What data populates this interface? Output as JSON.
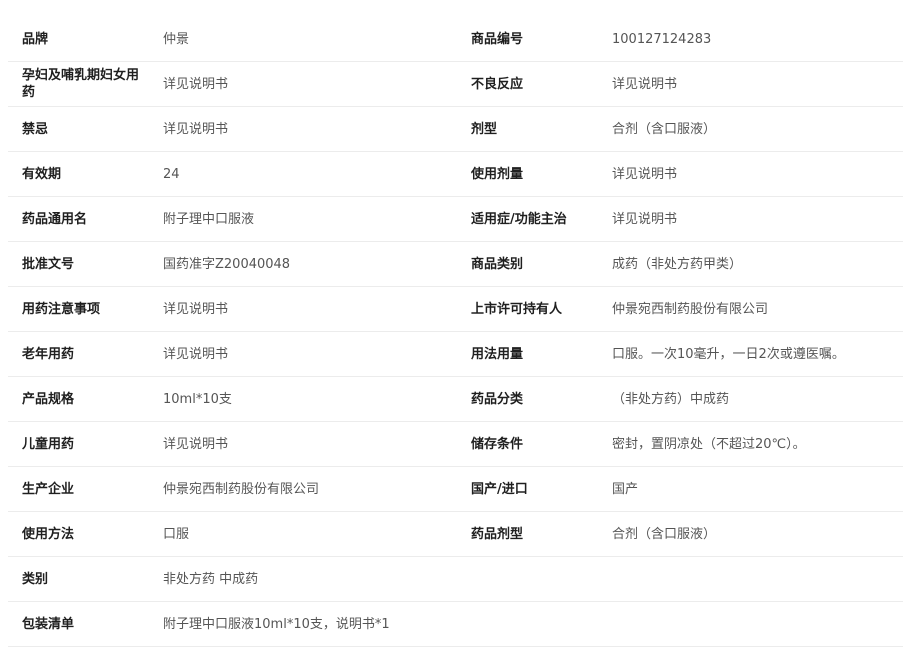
{
  "rows": [
    {
      "k1": "品牌",
      "v1": "仲景",
      "k2": "商品编号",
      "v2": "100127124283"
    },
    {
      "k1": "孕妇及哺乳期妇女用药",
      "v1": "详见说明书",
      "k2": "不良反应",
      "v2": "详见说明书"
    },
    {
      "k1": "禁忌",
      "v1": "详见说明书",
      "k2": "剂型",
      "v2": "合剂（含口服液）"
    },
    {
      "k1": "有效期",
      "v1": "24",
      "k2": "使用剂量",
      "v2": "详见说明书"
    },
    {
      "k1": "药品通用名",
      "v1": "附子理中口服液",
      "k2": "适用症/功能主治",
      "v2": "详见说明书"
    },
    {
      "k1": "批准文号",
      "v1": "国药准字Z20040048",
      "k2": "商品类别",
      "v2": "成药（非处方药甲类）"
    },
    {
      "k1": "用药注意事项",
      "v1": "详见说明书",
      "k2": "上市许可持有人",
      "v2": "仲景宛西制药股份有限公司"
    },
    {
      "k1": "老年用药",
      "v1": "详见说明书",
      "k2": "用法用量",
      "v2": "口服。一次10毫升，一日2次或遵医嘱。"
    },
    {
      "k1": "产品规格",
      "v1": "10ml*10支",
      "k2": "药品分类",
      "v2": "（非处方药）中成药"
    },
    {
      "k1": "儿童用药",
      "v1": "详见说明书",
      "k2": "储存条件",
      "v2": "密封，置阴凉处（不超过20℃）。"
    },
    {
      "k1": "生产企业",
      "v1": "仲景宛西制药股份有限公司",
      "k2": "国产/进口",
      "v2": "国产"
    },
    {
      "k1": "使用方法",
      "v1": "口服",
      "k2": "药品剂型",
      "v2": "合剂（含口服液）"
    },
    {
      "k1": "类别",
      "v1": "非处方药 中成药",
      "k2": "",
      "v2": ""
    },
    {
      "k1": "包装清单",
      "v1": "附子理中口服液10ml*10支，说明书*1",
      "k2": "",
      "v2": ""
    }
  ]
}
